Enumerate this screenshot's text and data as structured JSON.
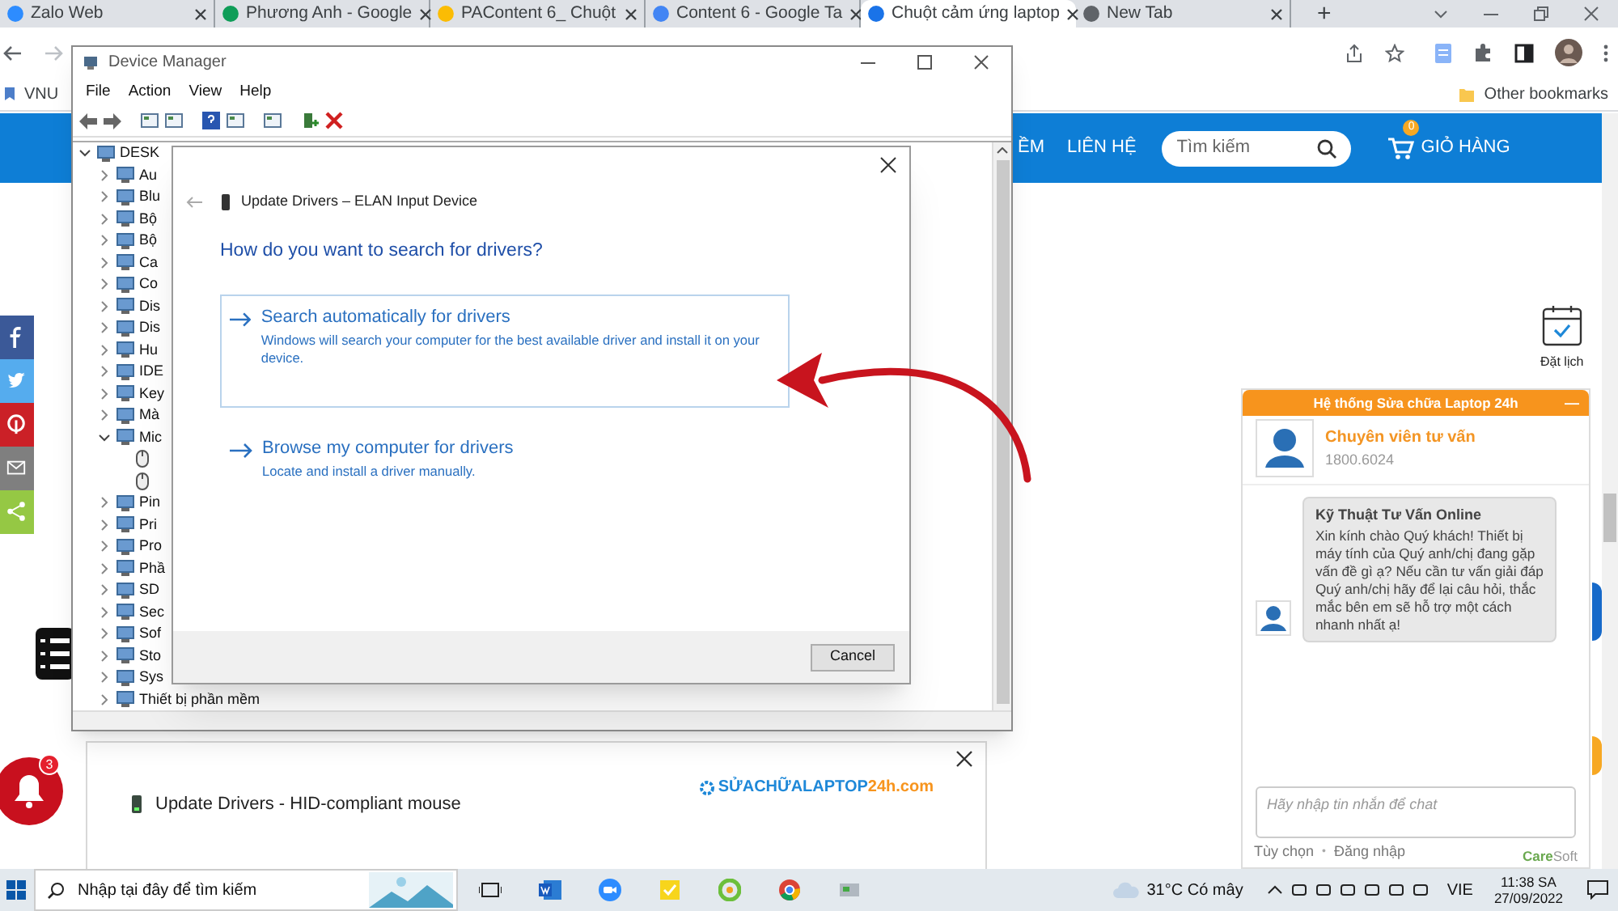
{
  "browser": {
    "tabs": [
      {
        "title": "Zalo Web",
        "selected": false
      },
      {
        "title": "Phương Anh - Google",
        "selected": false
      },
      {
        "title": "PAContent 6_ Chuột",
        "selected": false
      },
      {
        "title": "Content 6 - Google Ta",
        "selected": false
      },
      {
        "title": "Chuột cảm ứng laptop",
        "selected": true
      },
      {
        "title": "New Tab",
        "selected": false
      }
    ],
    "new_tab": "+",
    "bookmarks": [
      "VNU"
    ],
    "other_bookmarks": "Other bookmarks"
  },
  "site": {
    "nav": [
      "ỀM",
      "LIÊN HỆ"
    ],
    "search_placeholder": "Tìm kiếm",
    "cart": {
      "label": "GIỎ HÀNG",
      "count": "0"
    },
    "booking": "Đặt lịch",
    "notification_count": "3",
    "social": [
      {
        "kind": "facebook",
        "color": "#3b5998"
      },
      {
        "kind": "twitter",
        "color": "#55acee"
      },
      {
        "kind": "pinterest",
        "color": "#cb2027"
      },
      {
        "kind": "mail",
        "color": "#7f7f7f"
      },
      {
        "kind": "share",
        "color": "#95c844"
      }
    ]
  },
  "chat": {
    "header": "Hệ thống Sửa chữa Laptop 24h",
    "minimize": "—",
    "agent_name": "Chuyên viên tư vấn",
    "phone": "1800.6024",
    "sender": "Kỹ Thuật Tư Vấn Online",
    "message": "Xin kính chào Quý khách! Thiết bị máy tính của Quý anh/chị đang gặp vấn đề gì ạ? Nếu cần tư vấn giải đáp Quý anh/chị hãy để lại câu hỏi, thắc mắc bên em sẽ hỗ trợ một cách nhanh nhất ạ!",
    "input_placeholder": "Hãy nhập tin nhắn để chat",
    "links": [
      "Tùy chọn",
      "Đăng nhập"
    ],
    "link_separator": "•",
    "brand": {
      "first": "Care",
      "second": "Soft"
    }
  },
  "device_manager": {
    "title": "Device Manager",
    "menu": [
      "File",
      "Action",
      "View",
      "Help"
    ],
    "tree": [
      {
        "label": "DESK",
        "expanded": true,
        "children": [
          {
            "label": "Au",
            "expanded": false
          },
          {
            "label": "Blu",
            "expanded": false
          },
          {
            "label": "Bộ",
            "expanded": false
          },
          {
            "label": "Bộ",
            "expanded": false
          },
          {
            "label": "Ca",
            "expanded": false
          },
          {
            "label": "Co",
            "expanded": false
          },
          {
            "label": "Dis",
            "expanded": false
          },
          {
            "label": "Dis",
            "expanded": false
          },
          {
            "label": "Hu",
            "expanded": false
          },
          {
            "label": "IDE",
            "expanded": false
          },
          {
            "label": "Key",
            "expanded": false
          },
          {
            "label": "Mà",
            "expanded": false
          },
          {
            "label": "Mic",
            "expanded": true,
            "children": [
              {
                "kind": "mouse"
              },
              {
                "kind": "mouse"
              }
            ]
          },
          {
            "label": "Pin",
            "expanded": false
          },
          {
            "label": "Pri",
            "expanded": false
          },
          {
            "label": "Pro",
            "expanded": false
          },
          {
            "label": "Phầ",
            "expanded": false
          },
          {
            "label": "SD",
            "expanded": false
          },
          {
            "label": "Sec",
            "expanded": false
          },
          {
            "label": "Sof",
            "expanded": false
          },
          {
            "label": "Sto",
            "expanded": false
          },
          {
            "label": "Sys",
            "expanded": false
          },
          {
            "label": "Thiết bị phần mềm",
            "expanded": false
          }
        ]
      }
    ]
  },
  "dialog": {
    "title": "Update Drivers – ELAN Input Device",
    "question": "How do you want to search for drivers?",
    "options": [
      {
        "title": "Search automatically for drivers",
        "description": "Windows will search your computer for the best available driver and install it on your device.",
        "highlighted": true
      },
      {
        "title": "Browse my computer for drivers",
        "description": "Locate and install a driver manually.",
        "highlighted": false
      }
    ],
    "cancel": "Cancel"
  },
  "popup": {
    "title": "Update Drivers - HID-compliant mouse",
    "logo": {
      "main": "SỬACHỮALAPTOP",
      "accent": "24h.com"
    }
  },
  "taskbar": {
    "search_placeholder": "Nhập tại đây để tìm kiếm",
    "weather": "31°C Có mây",
    "language": "VIE",
    "time": "11:38 SA",
    "date": "27/09/2022"
  }
}
